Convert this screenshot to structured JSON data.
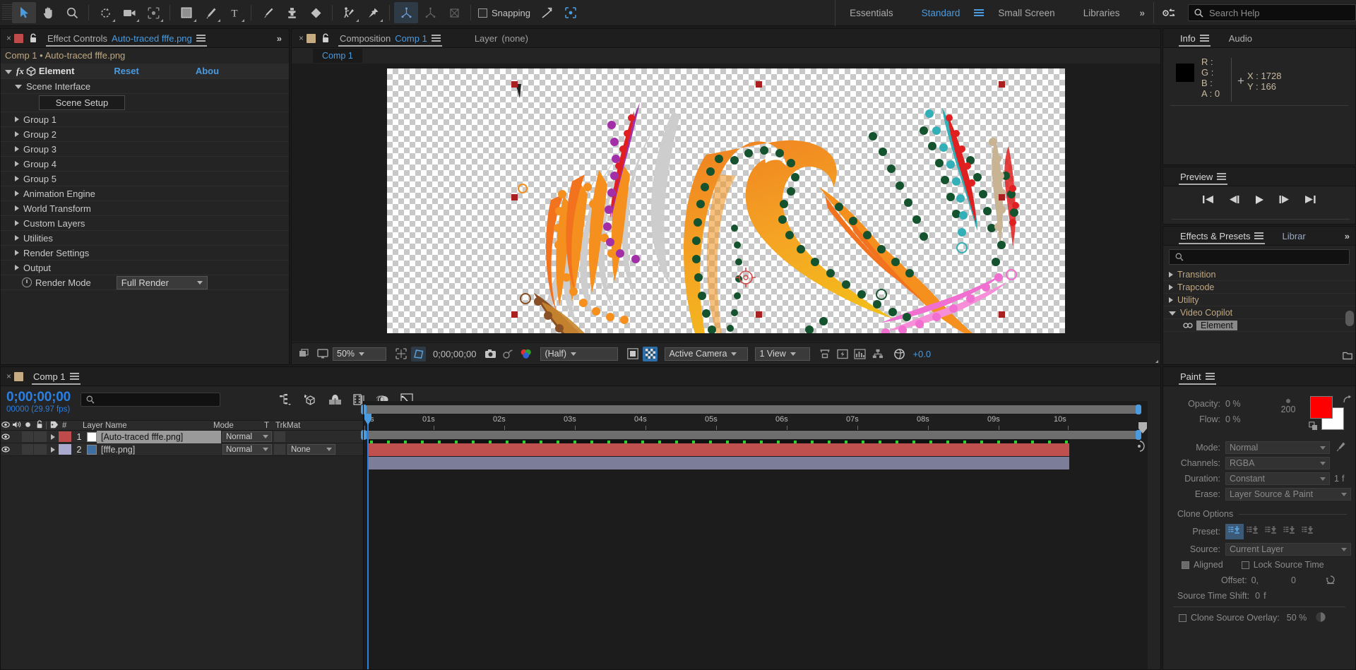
{
  "toolbar": {
    "tools": [
      {
        "name": "selection-tool",
        "icon": "arrow",
        "selected": true
      },
      {
        "name": "hand-tool",
        "icon": "hand",
        "selected": false
      },
      {
        "name": "zoom-tool",
        "icon": "magnifier",
        "selected": false
      },
      {
        "name": "rotation-tool",
        "icon": "rotate",
        "selected": false
      },
      {
        "name": "camera-tool",
        "icon": "camera",
        "selected": false
      },
      {
        "name": "pan-behind-tool",
        "icon": "anchor-region",
        "selected": false
      },
      {
        "name": "shape-tool",
        "icon": "rectangle",
        "selected": false
      },
      {
        "name": "pen-tool",
        "icon": "pen",
        "selected": false
      },
      {
        "name": "type-tool",
        "icon": "text-T",
        "selected": false
      },
      {
        "name": "brush-tool",
        "icon": "brush",
        "selected": false
      },
      {
        "name": "clone-stamp-tool",
        "icon": "stamp",
        "selected": false
      },
      {
        "name": "eraser-tool",
        "icon": "eraser",
        "selected": false
      },
      {
        "name": "roto-brush-tool",
        "icon": "roto-brush",
        "selected": false
      },
      {
        "name": "puppet-pin-tool",
        "icon": "pin",
        "selected": false
      }
    ],
    "axis_modes": [
      "local-axis",
      "world-axis",
      "view-axis"
    ],
    "snapping_label": "Snapping",
    "snapping_checked": false,
    "workspaces": [
      {
        "label": "Essentials",
        "active": false
      },
      {
        "label": "Standard",
        "active": true
      },
      {
        "label": "Small Screen",
        "active": false
      },
      {
        "label": "Libraries",
        "active": false
      }
    ],
    "overflow_label": "»",
    "search_help_placeholder": "Search Help"
  },
  "effect_controls": {
    "tab_label": "Effect Controls",
    "tab_name": "Auto-traced fffe.png",
    "breadcrumb": "Comp 1 • Auto-traced fffe.png",
    "effect_title": "Element",
    "reset_label": "Reset",
    "about_label": "Abou",
    "scene_interface_label": "Scene Interface",
    "scene_setup_label": "Scene Setup",
    "groups": [
      "Group 1",
      "Group 2",
      "Group 3",
      "Group 4",
      "Group 5",
      "Animation Engine",
      "World Transform",
      "Custom Layers",
      "Utilities",
      "Render Settings",
      "Output"
    ],
    "render_mode_label": "Render Mode",
    "render_mode_value": "Full Render",
    "overflow_label": "»"
  },
  "composition": {
    "tab_label": "Composition",
    "comp_name": "Comp 1",
    "layer_label": "Layer",
    "layer_value": "(none)",
    "subtab_label": "Comp 1",
    "zoom_level": "50%",
    "time_display": "0;00;00;00",
    "resolution": "(Half)",
    "camera_view": "Active Camera",
    "view_count": "1 View",
    "exposure": "+0.0",
    "artwork": {
      "alt": "auto-traced phoenix vector artwork on transparent checkerboard",
      "handle_color": "#aa2020"
    }
  },
  "timeline": {
    "tab_label": "Comp 1",
    "current_time": "0;00;00;00",
    "frame_info": "00000 (29.97 fps)",
    "columns": [
      "#",
      "Layer Name",
      "Mode",
      "T",
      "TrkMat"
    ],
    "layers": [
      {
        "index": "1",
        "name": "[Auto-traced fffe.png]",
        "mode": "Normal",
        "trkmat": "",
        "color": "#bf4a4a",
        "selected": true,
        "bar_color": "#c0504d"
      },
      {
        "index": "2",
        "name": "[fffe.png]",
        "mode": "Normal",
        "trkmat": "None",
        "color": "#a9a9cf",
        "selected": false,
        "bar_color": "#7b7d99"
      }
    ],
    "ruler_ticks": [
      "0s",
      "01s",
      "02s",
      "03s",
      "04s",
      "05s",
      "06s",
      "07s",
      "08s",
      "09s",
      "10s"
    ]
  },
  "info": {
    "tab_label": "Info",
    "audio_tab_label": "Audio",
    "r_label": "R :",
    "g_label": "G :",
    "b_label": "B :",
    "a_label": "A :",
    "r_value": "",
    "g_value": "",
    "b_value": "",
    "a_value": "0",
    "x_label": "X :",
    "x_value": "1728",
    "y_label": "Y :",
    "y_value": "166",
    "swatch_color": "#000000"
  },
  "preview": {
    "tab_label": "Preview",
    "buttons": [
      "first-frame",
      "previous-frame",
      "play",
      "next-frame",
      "last-frame"
    ]
  },
  "effects_presets": {
    "tab_label": "Effects & Presets",
    "library_tab_label": "Librar",
    "search_placeholder": "",
    "overflow_label": "»",
    "categories": [
      {
        "label": "Transition",
        "expanded": false
      },
      {
        "label": "Trapcode",
        "expanded": false
      },
      {
        "label": "Utility",
        "expanded": false
      },
      {
        "label": "Video Copilot",
        "expanded": true
      }
    ],
    "selected_effect": "Element"
  },
  "paint": {
    "tab_label": "Paint",
    "opacity_label": "Opacity:",
    "opacity_value": "0 %",
    "flow_label": "Flow:",
    "flow_value": "0 %",
    "brush_size": "200",
    "foreground_color": "#ff0000",
    "background_color": "#ffffff",
    "mode_label": "Mode:",
    "mode_value": "Normal",
    "channels_label": "Channels:",
    "channels_value": "RGBA",
    "duration_label": "Duration:",
    "duration_value": "Constant",
    "duration_frames": "1",
    "duration_unit": "f",
    "erase_label": "Erase:",
    "erase_value": "Layer Source & Paint",
    "clone_options_label": "Clone Options",
    "preset_label": "Preset:",
    "preset_count": 5,
    "preset_selected": 0,
    "source_label": "Source:",
    "source_value": "Current Layer",
    "aligned_label": "Aligned",
    "aligned_checked": true,
    "lock_source_label": "Lock Source Time",
    "lock_source_checked": false,
    "offset_label": "Offset:",
    "offset_x": "0",
    "offset_sep": ",",
    "offset_y": "0",
    "source_time_shift_label": "Source Time Shift:",
    "source_time_shift_value": "0",
    "source_time_shift_unit": "f",
    "clone_overlay_label": "Clone Source Overlay:",
    "clone_overlay_value": "50 %",
    "clone_overlay_checked": false
  }
}
